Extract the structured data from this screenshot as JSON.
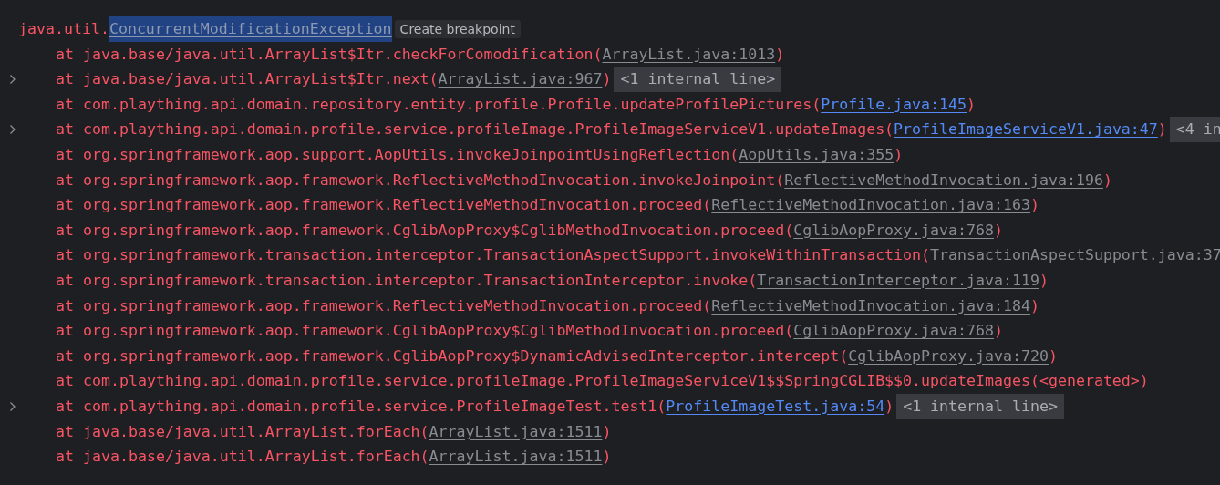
{
  "exception": {
    "package": "java.util.",
    "class_name": "ConcurrentModificationException",
    "selected": true,
    "hint": "Create breakpoint"
  },
  "frames": [
    {
      "expandable": false,
      "text": "at java.base/java.util.ArrayList$Itr.checkForComodification(",
      "link": {
        "text": "ArrayList.java:1013",
        "kind": "library"
      },
      "close": ")"
    },
    {
      "expandable": true,
      "text": "at java.base/java.util.ArrayList$Itr.next(",
      "link": {
        "text": "ArrayList.java:967",
        "kind": "library"
      },
      "close": ")",
      "badge": "<1 internal line>"
    },
    {
      "expandable": false,
      "text": "at com.plaything.api.domain.repository.entity.profile.Profile.updateProfilePictures(",
      "link": {
        "text": "Profile.java:145",
        "kind": "project"
      },
      "close": ")"
    },
    {
      "expandable": true,
      "text": "at com.plaything.api.domain.profile.service.profileImage.ProfileImageServiceV1.updateImages(",
      "link": {
        "text": "ProfileImageServiceV1.java:47",
        "kind": "project"
      },
      "close": ")",
      "badge": "<4 in"
    },
    {
      "expandable": false,
      "text": "at org.springframework.aop.support.AopUtils.invokeJoinpointUsingReflection(",
      "link": {
        "text": "AopUtils.java:355",
        "kind": "library"
      },
      "close": ")"
    },
    {
      "expandable": false,
      "text": "at org.springframework.aop.framework.ReflectiveMethodInvocation.invokeJoinpoint(",
      "link": {
        "text": "ReflectiveMethodInvocation.java:196",
        "kind": "library"
      },
      "close": ")"
    },
    {
      "expandable": false,
      "text": "at org.springframework.aop.framework.ReflectiveMethodInvocation.proceed(",
      "link": {
        "text": "ReflectiveMethodInvocation.java:163",
        "kind": "library"
      },
      "close": ")"
    },
    {
      "expandable": false,
      "text": "at org.springframework.aop.framework.CglibAopProxy$CglibMethodInvocation.proceed(",
      "link": {
        "text": "CglibAopProxy.java:768",
        "kind": "library"
      },
      "close": ")"
    },
    {
      "expandable": false,
      "text": "at org.springframework.transaction.interceptor.TransactionAspectSupport.invokeWithinTransaction(",
      "link": {
        "text": "TransactionAspectSupport.java:37",
        "kind": "library"
      }
    },
    {
      "expandable": false,
      "text": "at org.springframework.transaction.interceptor.TransactionInterceptor.invoke(",
      "link": {
        "text": "TransactionInterceptor.java:119",
        "kind": "library"
      },
      "close": ")"
    },
    {
      "expandable": false,
      "text": "at org.springframework.aop.framework.ReflectiveMethodInvocation.proceed(",
      "link": {
        "text": "ReflectiveMethodInvocation.java:184",
        "kind": "library"
      },
      "close": ")"
    },
    {
      "expandable": false,
      "text": "at org.springframework.aop.framework.CglibAopProxy$CglibMethodInvocation.proceed(",
      "link": {
        "text": "CglibAopProxy.java:768",
        "kind": "library"
      },
      "close": ")"
    },
    {
      "expandable": false,
      "text": "at org.springframework.aop.framework.CglibAopProxy$DynamicAdvisedInterceptor.intercept(",
      "link": {
        "text": "CglibAopProxy.java:720",
        "kind": "library"
      },
      "close": ")"
    },
    {
      "expandable": false,
      "text": "at com.plaything.api.domain.profile.service.profileImage.ProfileImageServiceV1$$SpringCGLIB$$0.updateImages(<generated>)"
    },
    {
      "expandable": true,
      "text": "at com.plaything.api.domain.profile.service.ProfileImageTest.test1(",
      "link": {
        "text": "ProfileImageTest.java:54",
        "kind": "project"
      },
      "close": ")",
      "badge": "<1 internal line>"
    },
    {
      "expandable": false,
      "text": "at java.base/java.util.ArrayList.forEach(",
      "link": {
        "text": "ArrayList.java:1511",
        "kind": "library"
      },
      "close": ")"
    },
    {
      "expandable": false,
      "text": "at java.base/java.util.ArrayList.forEach(",
      "link": {
        "text": "ArrayList.java:1511",
        "kind": "library"
      },
      "close": ")"
    }
  ]
}
